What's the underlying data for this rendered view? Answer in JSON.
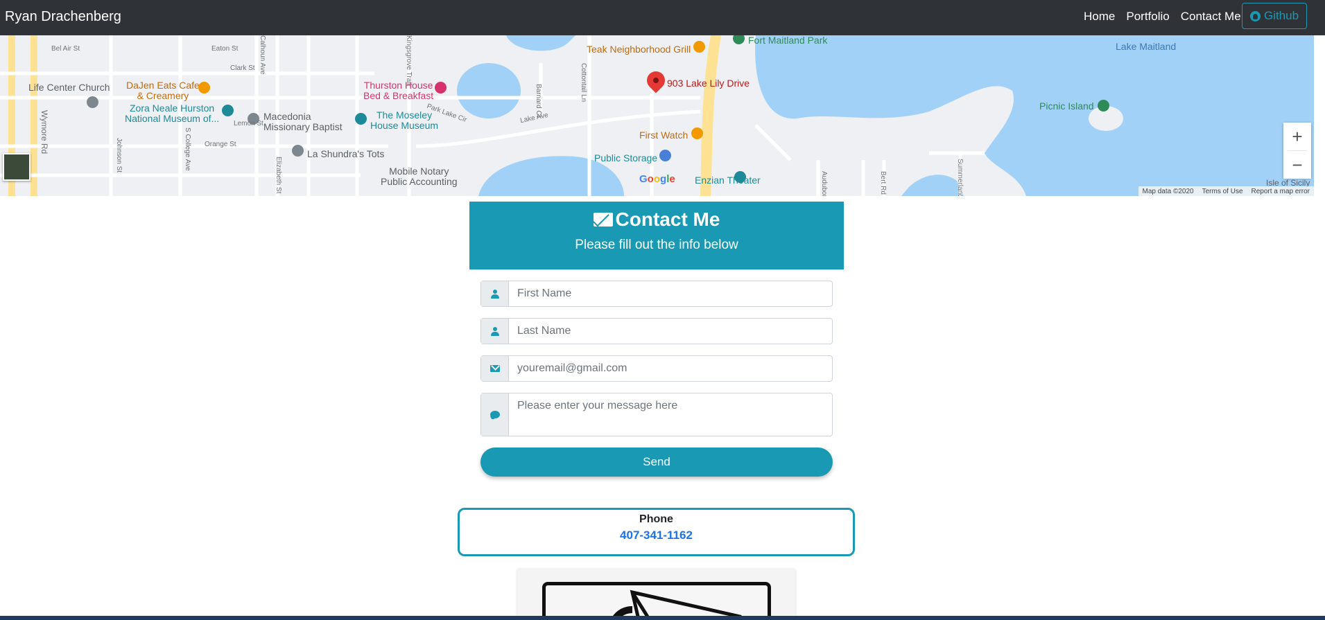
{
  "navbar": {
    "brand": "Ryan Drachenberg",
    "links": [
      "Home",
      "Portfolio",
      "Contact Me"
    ],
    "github_label": "Github"
  },
  "map": {
    "pin_label": "903 Lake Lily Drive",
    "lake_label": "Lake Maitland",
    "pois": {
      "fort_maitland": "Fort Maitland Park",
      "teak": "Teak Neighborhood Grill",
      "life_center": "Life Center Church",
      "dajen": "DaJen Eats Cafe\n& Creamery",
      "thurston": "Thurston House\nBed & Breakfast",
      "zora": "Zora Neale Hurston\nNational Museum of...",
      "macedonia": "Macedonia\nMissionary Baptist",
      "moseley": "The Moseley\nHouse Museum",
      "first_watch": "First Watch",
      "public_storage": "Public Storage",
      "la_shundra": "La Shundra's Tots",
      "mobile_notary": "Mobile Notary\nPublic Accounting",
      "enzian": "Enzian Theater",
      "picnic_island": "Picnic Island",
      "isle_sicily": "Isle of Sicily"
    },
    "streets": {
      "bel_air": "Bel Air St",
      "eaton": "Eaton St",
      "clark": "Clark St",
      "lemon": "Lemon St",
      "orange": "Orange St",
      "wymore": "Wymore Rd",
      "park_lake": "Park Lake Cir",
      "lake_ave": "Lake Ave",
      "calhoun": "Calhoun Ave",
      "kingsgrove": "Kingsgrove Trail",
      "cottontail": "Cottontail Ln",
      "barnard": "Barnard Ct",
      "johnson": "Johnson St",
      "college": "S College Ave",
      "elizabeth": "Elizabeth St",
      "audubon": "Audubon",
      "bert": "Bert Rd",
      "summerland": "Summerland"
    },
    "google_logo": "Google",
    "footer": [
      "Map data ©2020",
      "Terms of Use",
      "Report a map error"
    ],
    "zoom_in": "+",
    "zoom_out": "−"
  },
  "contact": {
    "title": "Contact Me",
    "subtitle": "Please fill out the info below"
  },
  "form": {
    "first_name_placeholder": "First Name",
    "last_name_placeholder": "Last Name",
    "email_placeholder": "youremail@gmail.com",
    "message_placeholder": "Please enter your message here",
    "send_label": "Send"
  },
  "phone": {
    "label": "Phone",
    "number": "407-341-1162"
  },
  "colors": {
    "accent": "#1a99b4",
    "navbar": "#2f3338",
    "water": "#a2d1f7",
    "link": "#1a73e8"
  }
}
